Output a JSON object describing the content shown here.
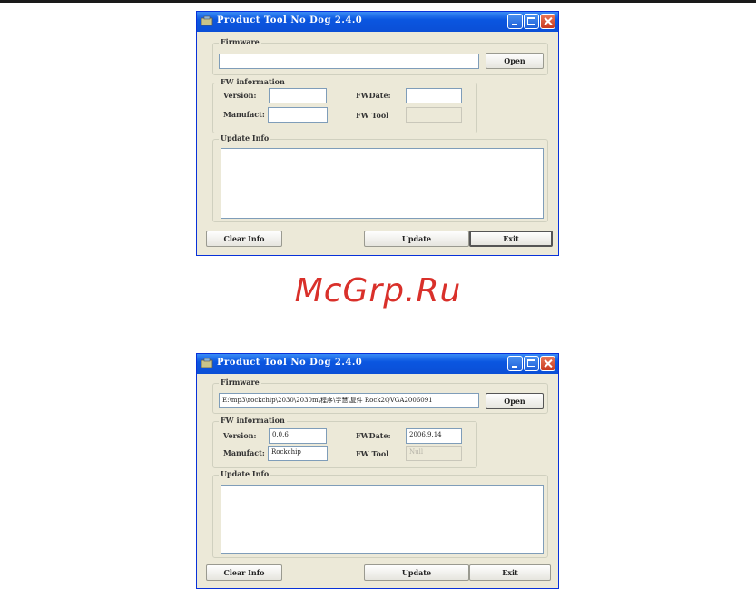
{
  "watermark": "McGrp.Ru",
  "window_title": "Product Tool No Dog 2.4.0",
  "labels": {
    "firmware": "Firmware",
    "fw_information": "FW information",
    "version": "Version:",
    "manufact": "Manufact:",
    "fwdate": "FWDate:",
    "fw_tool": "FW Tool",
    "update_info": "Update Info",
    "open": "Open",
    "clear_info": "Clear Info",
    "update": "Update",
    "exit": "Exit"
  },
  "window_before": {
    "firmware_path": "",
    "version": "",
    "manufact": "",
    "fwdate": "",
    "fw_tool": "",
    "update_info": ""
  },
  "window_after": {
    "firmware_path": "E:\\mp3\\rockchip\\2030\\2030m\\程序\\学慧\\复件 Rock2QVGA2006091",
    "version": "0.0.6",
    "manufact": "Rockchip",
    "fwdate": "2006.9.14",
    "fw_tool": "Null",
    "update_info": ""
  },
  "colors": {
    "titlebar": "#0b56e0",
    "window_bg": "#ece9d8",
    "watermark": "#d9302a"
  }
}
